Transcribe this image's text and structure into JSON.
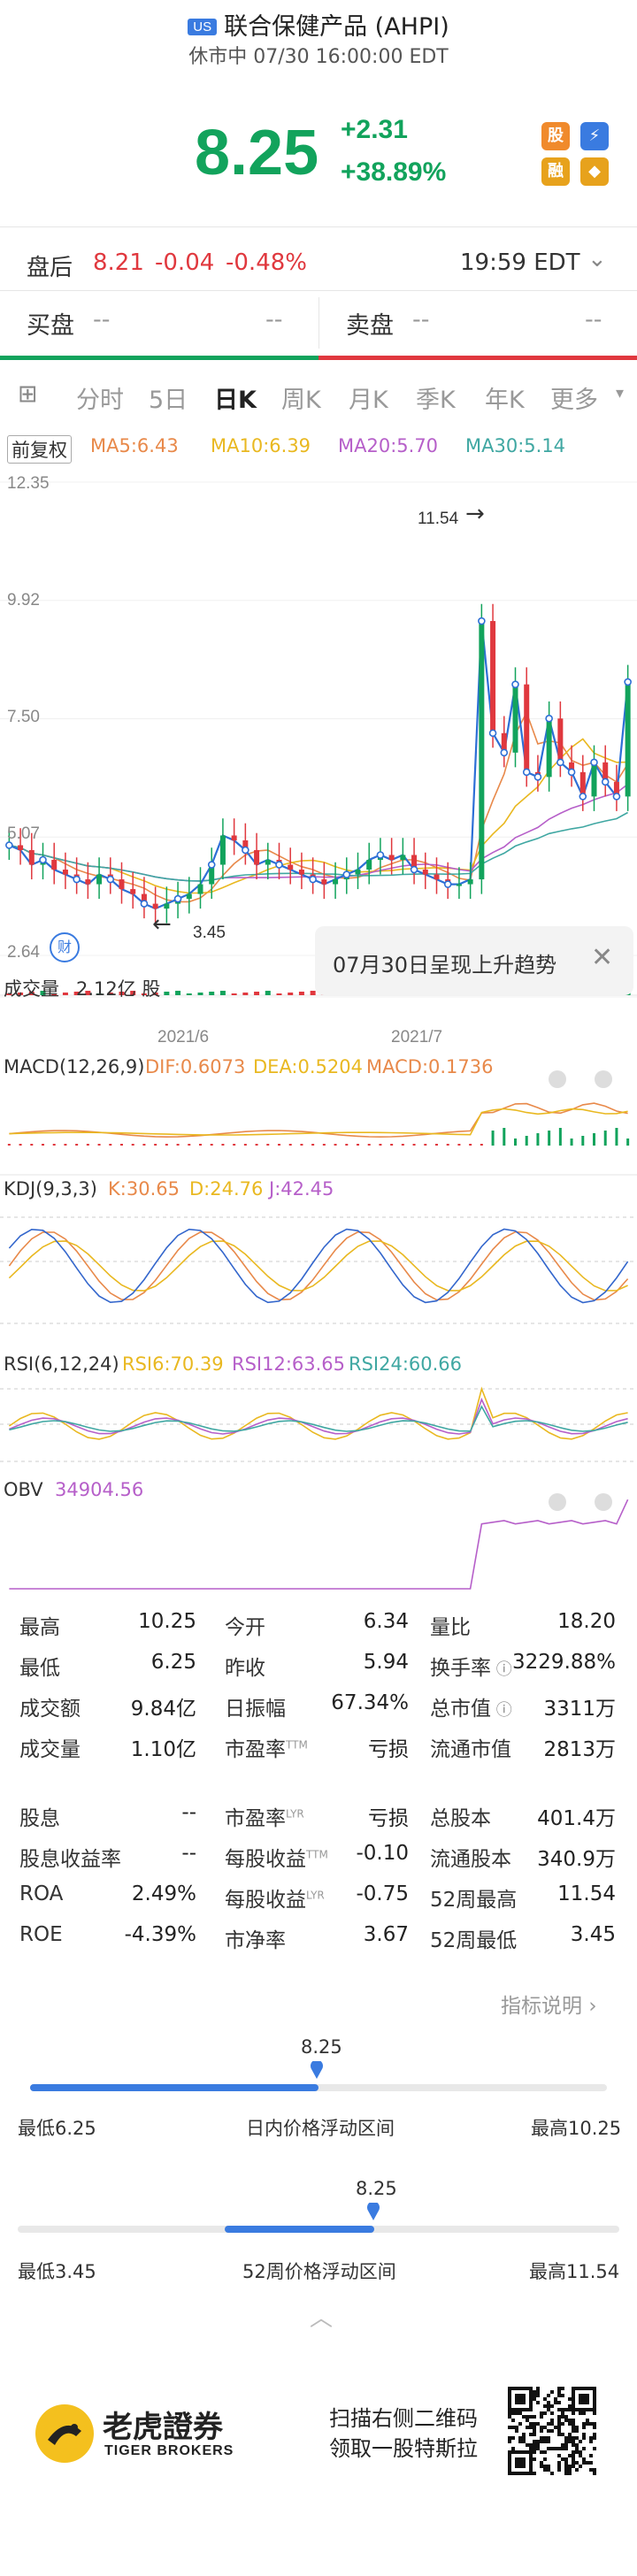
{
  "header": {
    "market_badge": "US",
    "title": "联合保健产品 (AHPI)",
    "status": "休市中 07/30 16:00:00 EDT",
    "price": "8.25",
    "change": "+2.31",
    "change_pct": "+38.89%",
    "icons": [
      "stock-icon",
      "lightning-icon",
      "finance-icon",
      "education-icon"
    ]
  },
  "after_hours": {
    "label": "盘后",
    "price": "8.21",
    "change": "-0.04",
    "change_pct": "-0.48%",
    "time": "19:59 EDT"
  },
  "bid_ask": {
    "bid_label": "买盘",
    "bid_value": "--",
    "bid_size": "--",
    "ask_label": "卖盘",
    "ask_value": "--",
    "ask_size": "--"
  },
  "tabs": [
    {
      "label": "分时"
    },
    {
      "label": "5日"
    },
    {
      "label": "日K"
    },
    {
      "label": "周K"
    },
    {
      "label": "月K"
    },
    {
      "label": "季K"
    },
    {
      "label": "年K"
    },
    {
      "label": "更多"
    }
  ],
  "active_tab": "日K",
  "ma": {
    "adjust": "前复权",
    "ma5": "MA5:6.43",
    "ma10": "MA10:6.39",
    "ma20": "MA20:5.70",
    "ma30": "MA30:5.14",
    "colors": {
      "ma5": "#e8894a",
      "ma10": "#e9b820",
      "ma20": "#b65fc9",
      "ma30": "#3fa7a2"
    }
  },
  "chart_data": {
    "type": "candlestick",
    "y_ticks": [
      "12.35",
      "9.92",
      "7.50",
      "5.07",
      "2.64"
    ],
    "x_ticks": [
      "2021/6",
      "2021/7"
    ],
    "high_marker": "11.54",
    "low_marker": "3.45",
    "volume_label": "成交量",
    "volume_value": "2.12亿 股",
    "close": [
      4.9,
      4.8,
      4.5,
      4.6,
      4.4,
      4.3,
      4.2,
      4.1,
      4.3,
      4.2,
      4.0,
      3.9,
      3.7,
      3.6,
      3.7,
      3.8,
      3.9,
      4.1,
      4.5,
      5.1,
      5.0,
      4.8,
      4.5,
      4.6,
      4.5,
      4.4,
      4.3,
      4.2,
      4.1,
      4.2,
      4.3,
      4.4,
      4.6,
      4.7,
      4.6,
      4.7,
      4.4,
      4.3,
      4.2,
      4.1,
      4.1,
      4.2,
      9.5,
      7.2,
      6.8,
      8.2,
      6.4,
      6.3,
      7.5,
      6.6,
      6.4,
      5.9,
      6.6,
      6.2,
      5.9,
      8.25
    ],
    "ma5_start_end": [
      5.0,
      6.43
    ],
    "tooltip": "07月30日呈现上升趋势"
  },
  "indicators": {
    "macd": {
      "name": "MACD(12,26,9)",
      "dif": "DIF:0.6073",
      "dea": "DEA:0.5204",
      "macd": "MACD:0.1736"
    },
    "kdj": {
      "name": "KDJ(9,3,3)",
      "k": "K:30.65",
      "d": "D:24.76",
      "j": "J:42.45"
    },
    "rsi": {
      "name": "RSI(6,12,24)",
      "rsi6": "RSI6:70.39",
      "rsi12": "RSI12:63.65",
      "rsi24": "RSI24:60.66"
    },
    "obv": {
      "name": "OBV",
      "value": "34904.56"
    }
  },
  "stats": [
    [
      {
        "l": "最高",
        "v": "10.25"
      },
      {
        "l": "今开",
        "v": "6.34"
      },
      {
        "l": "量比",
        "v": "18.20"
      }
    ],
    [
      {
        "l": "最低",
        "v": "6.25"
      },
      {
        "l": "昨收",
        "v": "5.94"
      },
      {
        "l": "换手率",
        "v": "3229.88%"
      }
    ],
    [
      {
        "l": "成交额",
        "v": "9.84亿"
      },
      {
        "l": "日振幅",
        "v": "67.34%"
      },
      {
        "l": "总市值",
        "v": "3311万"
      }
    ],
    [
      {
        "l": "成交量",
        "v": "1.10亿"
      },
      {
        "l": "市盈率",
        "v": "亏损"
      },
      {
        "l": "流通市值",
        "v": "2813万"
      }
    ],
    [
      {
        "l": "股息",
        "v": "--"
      },
      {
        "l": "市盈率",
        "v": "亏损"
      },
      {
        "l": "总股本",
        "v": "401.4万"
      }
    ],
    [
      {
        "l": "股息收益率",
        "v": "--"
      },
      {
        "l": "每股收益",
        "v": "-0.10"
      },
      {
        "l": "流通股本",
        "v": "340.9万"
      }
    ],
    [
      {
        "l": "ROA",
        "v": "2.49%"
      },
      {
        "l": "每股收益",
        "v": "-0.75"
      },
      {
        "l": "52周最高",
        "v": "11.54"
      }
    ],
    [
      {
        "l": "ROE",
        "v": "-4.39%"
      },
      {
        "l": "市净率",
        "v": "3.67"
      },
      {
        "l": "52周最低",
        "v": "3.45"
      }
    ]
  ],
  "stat_superscripts": {
    "pe_ttm": "TTM",
    "pe_lyr": "LYR",
    "eps_ttm": "TTM",
    "eps_lyr": "LYR"
  },
  "indicator_help": "指标说明",
  "ranges": {
    "day": {
      "current": "8.25",
      "low_label": "最低6.25",
      "title": "日内价格浮动区间",
      "high_label": "最高10.25",
      "fill": 0.5
    },
    "week52": {
      "current": "8.25",
      "low_label": "最低3.45",
      "title": "52周价格浮动区间",
      "high_label": "最高11.54",
      "fill": 0.593
    }
  },
  "footer": {
    "brand_cn": "老虎證券",
    "brand_en": "TIGER BROKERS",
    "promo_line1": "扫描右侧二维码",
    "promo_line2": "领取一股特斯拉"
  }
}
